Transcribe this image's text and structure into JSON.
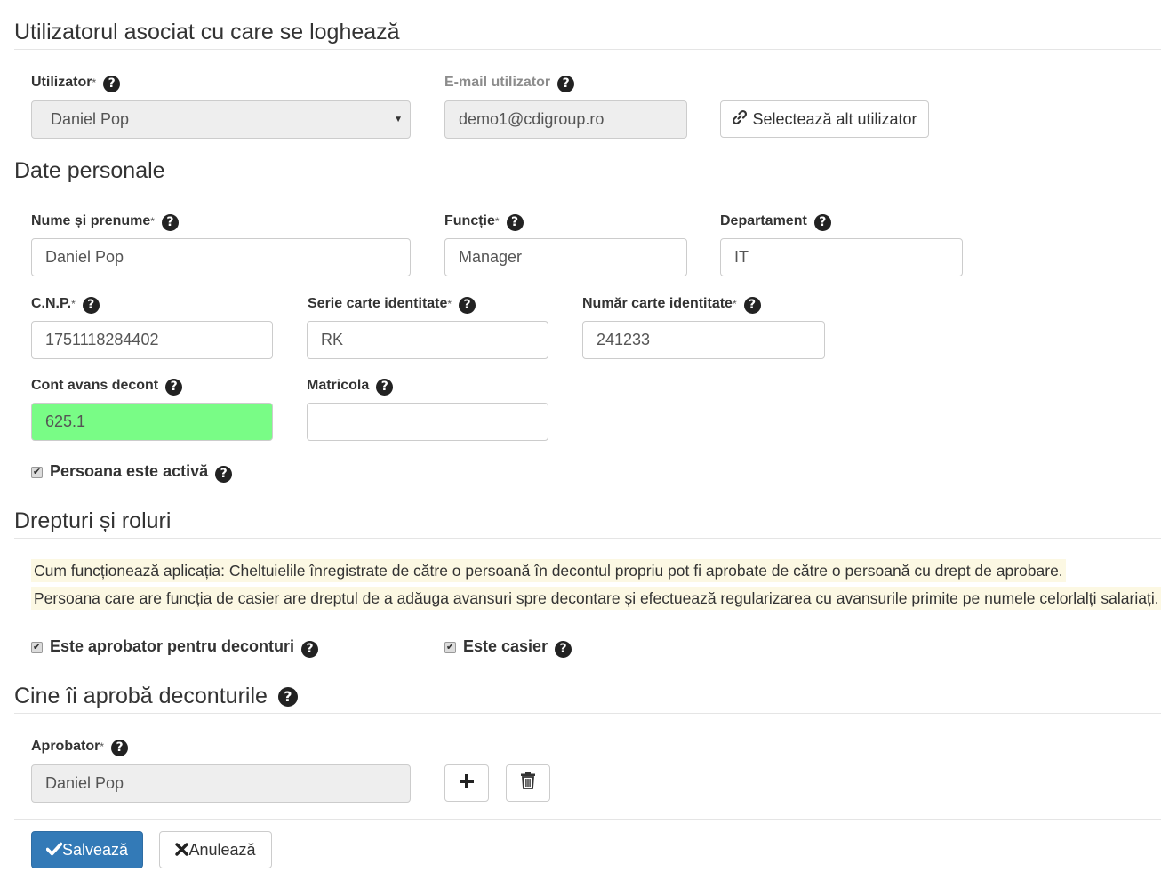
{
  "sections": {
    "login_user": "Utilizatorul asociat cu care se loghează",
    "personal": "Date personale",
    "rights": "Drepturi și roluri",
    "approvers": "Cine îi aprobă deconturile"
  },
  "login": {
    "user_label": "Utilizator",
    "user_value": "Daniel Pop",
    "email_label": "E-mail utilizator",
    "email_value": "demo1@cdigroup.ro",
    "select_button": "Selectează alt utilizator"
  },
  "personal": {
    "name_label": "Nume și prenume",
    "name_value": "Daniel Pop",
    "function_label": "Funcție",
    "function_value": "Manager",
    "department_label": "Departament",
    "department_value": "IT",
    "cnp_label": "C.N.P.",
    "cnp_value": "1751118284402",
    "id_series_label": "Serie carte identitate",
    "id_series_value": "RK",
    "id_number_label": "Număr carte identitate",
    "id_number_value": "241233",
    "advance_account_label": "Cont avans decont",
    "advance_account_value": "625.1",
    "registration_label": "Matricola",
    "registration_value": "",
    "active_label": "Persoana este activă",
    "active_checked": true
  },
  "rights": {
    "note1": "Cum funcționează aplicația: Cheltuielile înregistrate de către o persoană în decontul propriu pot fi aprobate de către o persoană cu drept de aprobare.",
    "note2": "Persoana care are funcția de casier are dreptul de a adăuga avansuri spre decontare și efectuează regularizarea cu avansurile primite pe numele celorlalți salariați.",
    "approver_label": "Este aprobator pentru deconturi",
    "approver_checked": true,
    "cashier_label": "Este casier",
    "cashier_checked": true
  },
  "approvers": {
    "approver_label": "Aprobator",
    "approver_value": "Daniel Pop"
  },
  "actions": {
    "save": "Salvează",
    "cancel": "Anulează"
  },
  "common": {
    "required_mark": "*",
    "help_glyph": "?",
    "checkmark_glyph": "✔"
  },
  "colors": {
    "primary": "#337ab7",
    "highlight_green": "#79fc86",
    "note_background": "#fcf8e3"
  }
}
